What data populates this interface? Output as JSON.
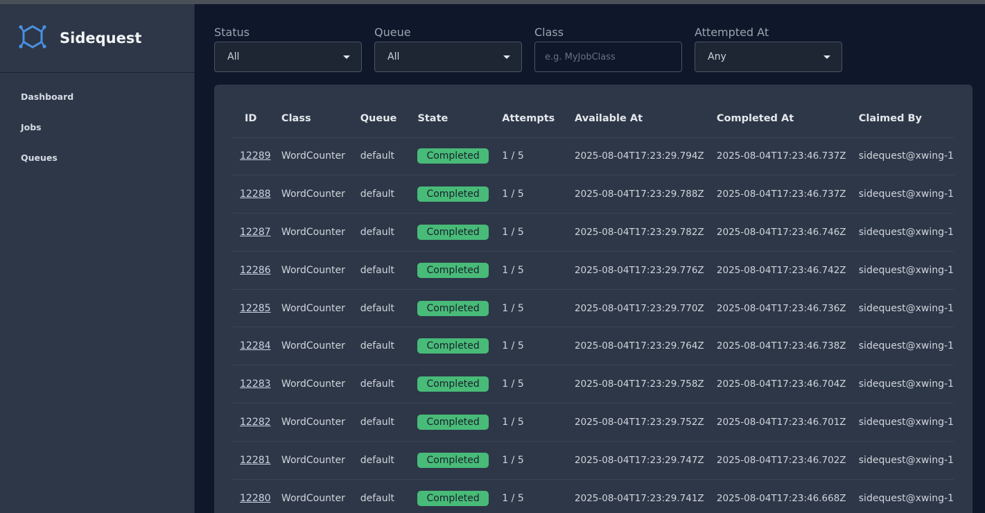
{
  "app": {
    "name": "Sidequest",
    "brand_color": "#4a90e2"
  },
  "sidebar": {
    "items": [
      {
        "label": "Dashboard"
      },
      {
        "label": "Jobs"
      },
      {
        "label": "Queues"
      }
    ]
  },
  "filters": {
    "status": {
      "label": "Status",
      "value": "All"
    },
    "queue": {
      "label": "Queue",
      "value": "All"
    },
    "class": {
      "label": "Class",
      "placeholder": "e.g. MyJobClass"
    },
    "attempted_at": {
      "label": "Attempted At",
      "value": "Any"
    }
  },
  "table": {
    "headers": [
      "ID",
      "Class",
      "Queue",
      "State",
      "Attempts",
      "Available At",
      "Completed At",
      "Claimed By"
    ],
    "rows": [
      {
        "id": "12289",
        "class": "WordCounter",
        "queue": "default",
        "state": "Completed",
        "attempts": "1 / 5",
        "available_at": "2025-08-04T17:23:29.794Z",
        "completed_at": "2025-08-04T17:23:46.737Z",
        "claimed_by": "sidequest@xwing-1"
      },
      {
        "id": "12288",
        "class": "WordCounter",
        "queue": "default",
        "state": "Completed",
        "attempts": "1 / 5",
        "available_at": "2025-08-04T17:23:29.788Z",
        "completed_at": "2025-08-04T17:23:46.737Z",
        "claimed_by": "sidequest@xwing-1"
      },
      {
        "id": "12287",
        "class": "WordCounter",
        "queue": "default",
        "state": "Completed",
        "attempts": "1 / 5",
        "available_at": "2025-08-04T17:23:29.782Z",
        "completed_at": "2025-08-04T17:23:46.746Z",
        "claimed_by": "sidequest@xwing-1"
      },
      {
        "id": "12286",
        "class": "WordCounter",
        "queue": "default",
        "state": "Completed",
        "attempts": "1 / 5",
        "available_at": "2025-08-04T17:23:29.776Z",
        "completed_at": "2025-08-04T17:23:46.742Z",
        "claimed_by": "sidequest@xwing-1"
      },
      {
        "id": "12285",
        "class": "WordCounter",
        "queue": "default",
        "state": "Completed",
        "attempts": "1 / 5",
        "available_at": "2025-08-04T17:23:29.770Z",
        "completed_at": "2025-08-04T17:23:46.736Z",
        "claimed_by": "sidequest@xwing-1"
      },
      {
        "id": "12284",
        "class": "WordCounter",
        "queue": "default",
        "state": "Completed",
        "attempts": "1 / 5",
        "available_at": "2025-08-04T17:23:29.764Z",
        "completed_at": "2025-08-04T17:23:46.738Z",
        "claimed_by": "sidequest@xwing-1"
      },
      {
        "id": "12283",
        "class": "WordCounter",
        "queue": "default",
        "state": "Completed",
        "attempts": "1 / 5",
        "available_at": "2025-08-04T17:23:29.758Z",
        "completed_at": "2025-08-04T17:23:46.704Z",
        "claimed_by": "sidequest@xwing-1"
      },
      {
        "id": "12282",
        "class": "WordCounter",
        "queue": "default",
        "state": "Completed",
        "attempts": "1 / 5",
        "available_at": "2025-08-04T17:23:29.752Z",
        "completed_at": "2025-08-04T17:23:46.701Z",
        "claimed_by": "sidequest@xwing-1"
      },
      {
        "id": "12281",
        "class": "WordCounter",
        "queue": "default",
        "state": "Completed",
        "attempts": "1 / 5",
        "available_at": "2025-08-04T17:23:29.747Z",
        "completed_at": "2025-08-04T17:23:46.702Z",
        "claimed_by": "sidequest@xwing-1"
      },
      {
        "id": "12280",
        "class": "WordCounter",
        "queue": "default",
        "state": "Completed",
        "attempts": "1 / 5",
        "available_at": "2025-08-04T17:23:29.741Z",
        "completed_at": "2025-08-04T17:23:46.668Z",
        "claimed_by": "sidequest@xwing-1"
      }
    ]
  }
}
